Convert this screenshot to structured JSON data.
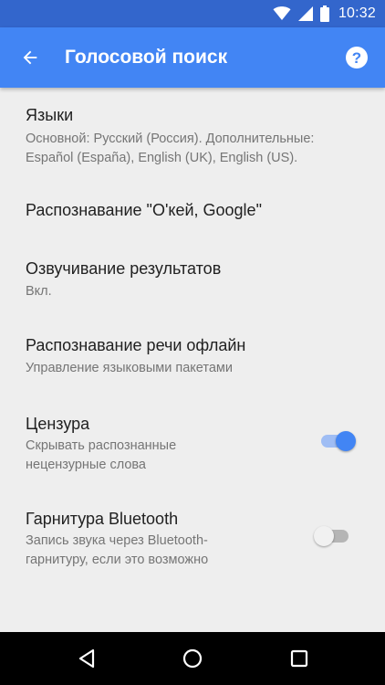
{
  "status_bar": {
    "time": "10:32",
    "icons": [
      "wifi-icon",
      "cell-signal-icon",
      "battery-icon"
    ]
  },
  "toolbar": {
    "title": "Голосовой поиск",
    "back_icon": "arrow-back-icon",
    "help_icon": "help-circle-icon",
    "color": "#4285f4"
  },
  "settings": [
    {
      "title": "Языки",
      "summary_lines": [
        "Основной: Русский (Россия). Дополнительные:",
        "Español (España), English (UK), English (US)."
      ]
    },
    {
      "title": "Распознавание \"О'кей, Google\"",
      "summary_lines": []
    },
    {
      "title": "Озвучивание результатов",
      "summary_lines": [
        "Вкл."
      ]
    },
    {
      "title": "Распознавание речи офлайн",
      "summary_lines": [
        "Управление языковыми пакетами"
      ]
    },
    {
      "title": "Цензура",
      "summary_lines": [
        "Скрывать распознанные",
        "нецензурные слова"
      ],
      "toggle": true
    },
    {
      "title": "Гарнитура Bluetooth",
      "summary_lines": [
        "Запись звука через Bluetooth-",
        "гарнитуру, если это возможно"
      ],
      "toggle": false
    }
  ],
  "nav_bar": {
    "icons": [
      "back-triangle-icon",
      "home-circle-icon",
      "recents-square-icon"
    ]
  }
}
